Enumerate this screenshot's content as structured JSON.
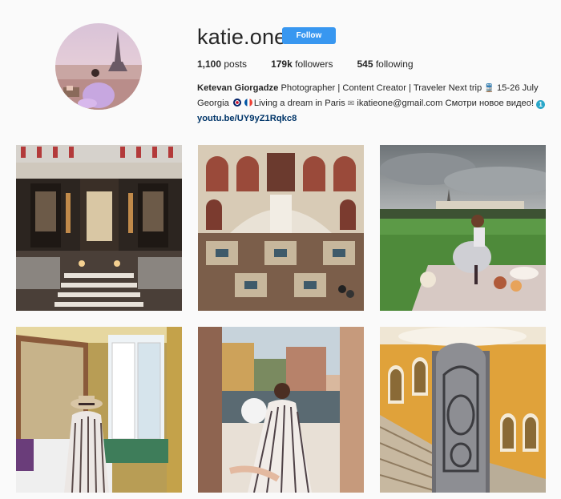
{
  "profile": {
    "username": "katie.one",
    "follow_label": "Follow",
    "stats": {
      "posts_count": "1,100",
      "posts_label": "posts",
      "followers_count": "179k",
      "followers_label": "followers",
      "following_count": "545",
      "following_label": "following"
    },
    "bio": {
      "name": "Ketevan Giorgadze",
      "line1_text": "Photographer | Content Creator | Traveler Next trip",
      "line1_trip": "15-26 July",
      "line2_place": "Georgia",
      "line2_text": "Living a dream in Paris",
      "line2_email": "ikatieone@gmail.com Смотри новое видео!",
      "link": "youtu.be/UY9yZ1Rqkc8"
    },
    "colors": {
      "follow_button": "#3897f0",
      "link": "#003569",
      "background": "#fafafa"
    }
  },
  "posts": [
    {
      "subject": "ornate art deco hotel lobby"
    },
    {
      "subject": "palace staircase atrium with mosaic floor"
    },
    {
      "subject": "picnic on lawn under cloudy sky"
    },
    {
      "subject": "woman in hat sitting by open window"
    },
    {
      "subject": "woman sitting at window overlooking canal"
    },
    {
      "subject": "spiral staircase with ornate elevator"
    }
  ]
}
